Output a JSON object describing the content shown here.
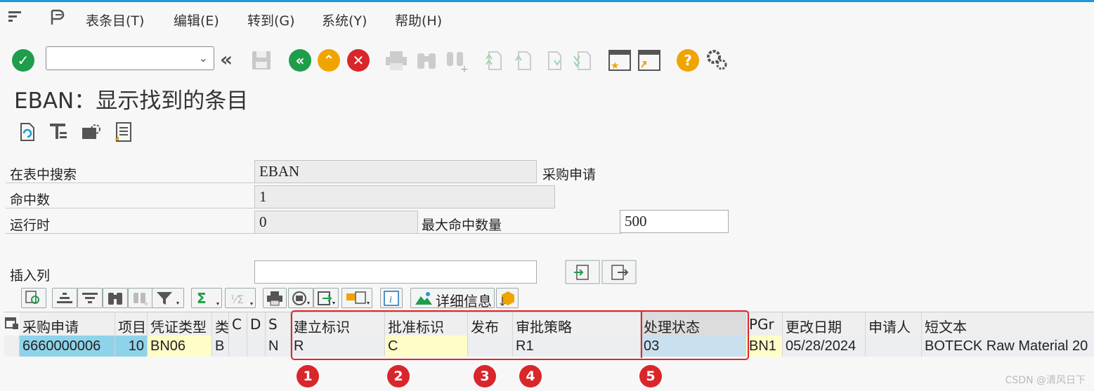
{
  "menu": {
    "items": [
      "表条目(T)",
      "编辑(E)",
      "转到(G)",
      "系统(Y)",
      "帮助(H)"
    ]
  },
  "toolbar": {
    "command_value": ""
  },
  "title": "EBAN：显示找到的条目",
  "form": {
    "search_table_label": "在表中搜索",
    "search_table_value": "EBAN",
    "search_table_desc": "采购申请",
    "hits_label": "命中数",
    "hits_value": "1",
    "runtime_label": "运行时",
    "runtime_value": "0",
    "max_hits_label": "最大命中数量",
    "max_hits_value": "500",
    "insert_column_label": "插入列",
    "insert_column_value": ""
  },
  "alv": {
    "detail_label": "详细信息"
  },
  "grid": {
    "columns": [
      "采购申请",
      "项目",
      "凭证类型",
      "类",
      "C",
      "D",
      "S",
      "建立标识",
      "批准标识",
      "发布",
      "审批策略",
      "处理状态",
      "PGr",
      "更改日期",
      "申请人",
      "短文本"
    ],
    "rows": [
      [
        "6660000006",
        "10",
        "BN06",
        "B",
        "",
        "",
        "N",
        "R",
        "C",
        "",
        "R1",
        "03",
        "BN1",
        "05/28/2024",
        "",
        "BOTECK Raw Material 20"
      ]
    ]
  },
  "markers": [
    "1",
    "2",
    "3",
    "4",
    "5"
  ],
  "watermark": "CSDN @清风日下",
  "colors": {
    "accent_blue": "#1c9ad6",
    "highlight_red": "#e0262b",
    "key_cell": "#8fd3ea",
    "edit_cell": "#fffdc8"
  }
}
